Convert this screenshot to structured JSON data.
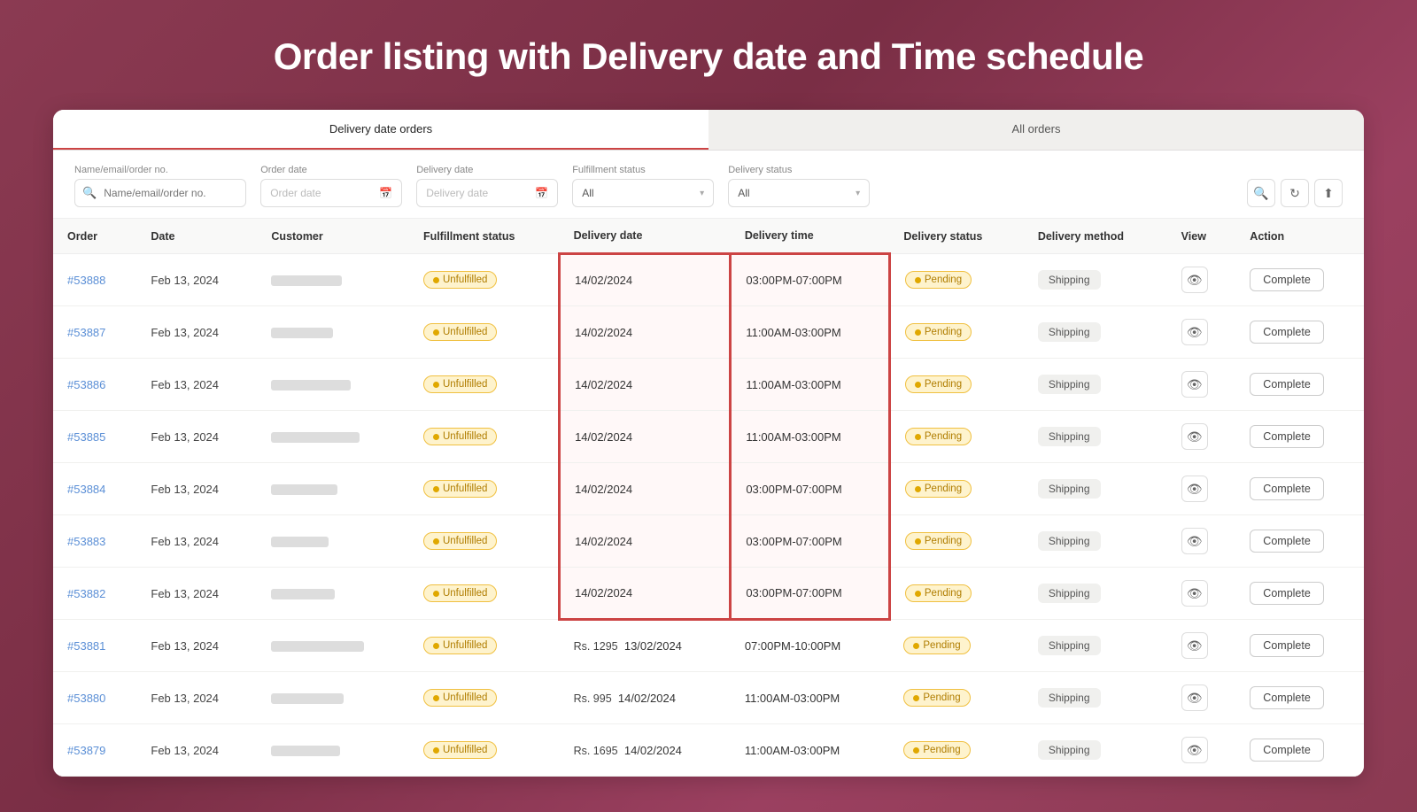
{
  "page": {
    "title": "Order listing with Delivery date and Time schedule"
  },
  "tabs": [
    {
      "id": "delivery",
      "label": "Delivery date orders",
      "active": true
    },
    {
      "id": "all",
      "label": "All orders",
      "active": false
    }
  ],
  "filters": {
    "name_email_label": "Name/email/order no.",
    "name_email_placeholder": "Name/email/order no.",
    "order_date_label": "Order date",
    "order_date_placeholder": "Order date",
    "delivery_date_label": "Delivery date",
    "delivery_date_placeholder": "Delivery date",
    "fulfillment_label": "Fulfillment status",
    "fulfillment_value": "All",
    "delivery_status_label": "Delivery status",
    "delivery_status_value": "All"
  },
  "table": {
    "columns": [
      "Order",
      "Date",
      "Customer",
      "Fulfillment status",
      "Delivery date",
      "Delivery time",
      "Delivery status",
      "Delivery method",
      "View",
      "Action"
    ],
    "rows": [
      {
        "order": "#53888",
        "date": "Feb 13, 2024",
        "customer_width": 80,
        "fulfillment": "Unfulfilled",
        "delivery_date": "14/02/2024",
        "delivery_time": "03:00PM-07:00PM",
        "delivery_status": "Pending",
        "delivery_method": "Shipping",
        "action": "Complete",
        "highlight_date": true,
        "highlight_time": true,
        "top_border": true,
        "bottom_border": false
      },
      {
        "order": "#53887",
        "date": "Feb 13, 2024",
        "customer_width": 70,
        "fulfillment": "Unfulfilled",
        "delivery_date": "14/02/2024",
        "delivery_time": "11:00AM-03:00PM",
        "delivery_status": "Pending",
        "delivery_method": "Shipping",
        "action": "Complete",
        "highlight_date": true,
        "highlight_time": true,
        "top_border": false,
        "bottom_border": false
      },
      {
        "order": "#53886",
        "date": "Feb 13, 2024",
        "customer_width": 90,
        "fulfillment": "Unfulfilled",
        "delivery_date": "14/02/2024",
        "delivery_time": "11:00AM-03:00PM",
        "delivery_status": "Pending",
        "delivery_method": "Shipping",
        "action": "Complete",
        "highlight_date": true,
        "highlight_time": true,
        "top_border": false,
        "bottom_border": false
      },
      {
        "order": "#53885",
        "date": "Feb 13, 2024",
        "customer_width": 100,
        "fulfillment": "Unfulfilled",
        "delivery_date": "14/02/2024",
        "delivery_time": "11:00AM-03:00PM",
        "delivery_status": "Pending",
        "delivery_method": "Shipping",
        "action": "Complete",
        "highlight_date": true,
        "highlight_time": true,
        "top_border": false,
        "bottom_border": false
      },
      {
        "order": "#53884",
        "date": "Feb 13, 2024",
        "customer_width": 75,
        "fulfillment": "Unfulfilled",
        "delivery_date": "14/02/2024",
        "delivery_time": "03:00PM-07:00PM",
        "delivery_status": "Pending",
        "delivery_method": "Shipping",
        "action": "Complete",
        "highlight_date": true,
        "highlight_time": true,
        "top_border": false,
        "bottom_border": false
      },
      {
        "order": "#53883",
        "date": "Feb 13, 2024",
        "customer_width": 65,
        "fulfillment": "Unfulfilled",
        "delivery_date": "14/02/2024",
        "delivery_time": "03:00PM-07:00PM",
        "delivery_status": "Pending",
        "delivery_method": "Shipping",
        "action": "Complete",
        "highlight_date": true,
        "highlight_time": true,
        "top_border": false,
        "bottom_border": false
      },
      {
        "order": "#53882",
        "date": "Feb 13, 2024",
        "customer_width": 72,
        "fulfillment": "Unfulfilled",
        "delivery_date": "14/02/2024",
        "delivery_time": "03:00PM-07:00PM",
        "delivery_status": "Pending",
        "delivery_method": "Shipping",
        "action": "Complete",
        "highlight_date": true,
        "highlight_time": true,
        "top_border": false,
        "bottom_border": true
      },
      {
        "order": "#53881",
        "date": "Feb 13, 2024",
        "customer_width": 105,
        "fulfillment": "Unfulfilled",
        "delivery_date": "Rs. 1295    13/02/2024",
        "delivery_time": "07:00PM-10:00PM",
        "delivery_status": "Pending",
        "delivery_method": "Shipping",
        "action": "Complete",
        "highlight_date": false,
        "highlight_time": false,
        "top_border": false,
        "bottom_border": false,
        "rs": true,
        "rs_val": "Rs. 1295",
        "plain_date": "13/02/2024"
      },
      {
        "order": "#53880",
        "date": "Feb 13, 2024",
        "customer_width": 82,
        "fulfillment": "Unfulfilled",
        "delivery_date": "Rs. 995    14/02/2024",
        "delivery_time": "11:00AM-03:00PM",
        "delivery_status": "Pending",
        "delivery_method": "Shipping",
        "action": "Complete",
        "highlight_date": false,
        "highlight_time": false,
        "top_border": false,
        "bottom_border": false,
        "rs": true,
        "rs_val": "Rs. 995",
        "plain_date": "14/02/2024"
      },
      {
        "order": "#53879",
        "date": "Feb 13, 2024",
        "customer_width": 78,
        "fulfillment": "Unfulfilled",
        "delivery_date": "Rs. 1695    14/02/2024",
        "delivery_time": "11:00AM-03:00PM",
        "delivery_status": "Pending",
        "delivery_method": "Shipping",
        "action": "Complete",
        "highlight_date": false,
        "highlight_time": false,
        "top_border": false,
        "bottom_border": false,
        "rs": true,
        "rs_val": "Rs. 1695",
        "plain_date": "14/02/2024"
      }
    ]
  }
}
